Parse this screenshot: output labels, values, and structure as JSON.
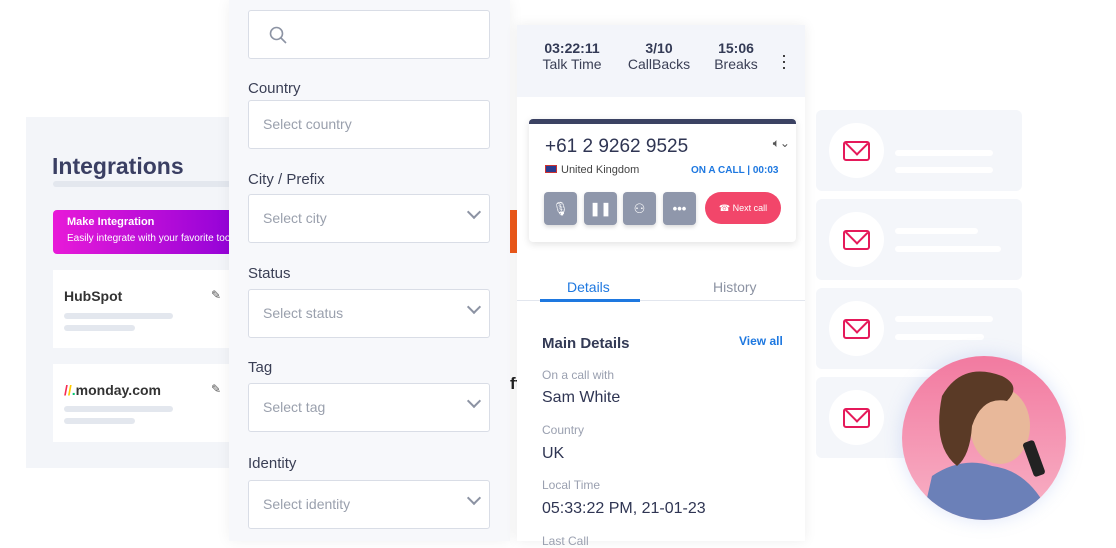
{
  "integrations": {
    "title": "Integrations",
    "banner": {
      "title": "Make Integration",
      "subtitle": "Easily integrate with your favorite tools"
    },
    "cards": [
      {
        "name": "HubSpot"
      },
      {
        "name": "monday.com"
      }
    ]
  },
  "filters": {
    "search_placeholder": "",
    "fields": [
      {
        "label": "Country",
        "placeholder": "Select country"
      },
      {
        "label": "City / Prefix",
        "placeholder": "Select city"
      },
      {
        "label": "Status",
        "placeholder": "Select status"
      },
      {
        "label": "Tag",
        "placeholder": "Select tag"
      },
      {
        "label": "Identity",
        "placeholder": "Select identity"
      }
    ]
  },
  "behind_text": "ft",
  "call": {
    "stats": [
      {
        "value": "03:22:11",
        "label": "Talk Time"
      },
      {
        "value": "3/10",
        "label": "CallBacks"
      },
      {
        "value": "15:06",
        "label": "Breaks"
      }
    ],
    "phone": "+61 2 9262 9525",
    "country": "United Kingdom",
    "status": "ON A CALL |  00:03",
    "next_call": "Next call",
    "tabs": [
      "Details",
      "History"
    ],
    "section_title": "Main Details",
    "view_all": "View all",
    "details": [
      {
        "label": "On a call with",
        "value": "Sam White"
      },
      {
        "label": "Country",
        "value": "UK"
      },
      {
        "label": "Local Time",
        "value": "05:33:22 PM, 21-01-23"
      },
      {
        "label": "Last Call",
        "value": ""
      }
    ]
  },
  "colors": {
    "accent": "#1e78e0",
    "danger": "#f2466a",
    "email": "#e5195a"
  }
}
